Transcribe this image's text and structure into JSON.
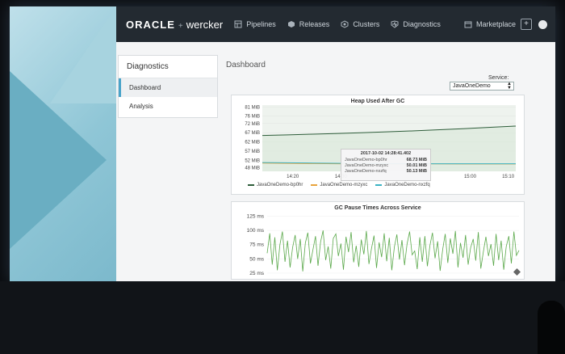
{
  "brand": {
    "oracle": "ORACLE",
    "plus": "+",
    "wercker": "wercker"
  },
  "nav": [
    {
      "label": "Pipelines",
      "icon": "pipelines-icon"
    },
    {
      "label": "Releases",
      "icon": "releases-icon"
    },
    {
      "label": "Clusters",
      "icon": "clusters-icon"
    },
    {
      "label": "Diagnostics",
      "icon": "diagnostics-icon"
    }
  ],
  "marketplace": {
    "label": "Marketplace",
    "plus": "+"
  },
  "sidebar": {
    "title": "Diagnostics",
    "items": [
      {
        "label": "Dashboard",
        "active": true
      },
      {
        "label": "Analysis",
        "active": false
      }
    ]
  },
  "main": {
    "title": "Dashboard"
  },
  "service": {
    "label": "Service:",
    "selected": "JavaOneDemo"
  },
  "colors": {
    "series1": "#2e5d3a",
    "series2": "#e8a33c",
    "series3": "#3bb3c3",
    "gcLine": "#5aa84a",
    "accent": "#49a3c9"
  },
  "heap_chart": {
    "title": "Heap Used After GC",
    "tooltip": {
      "timestamp": "2017-10-02 14:28:41.402",
      "rows": [
        {
          "name": "JavaOneDemo-bp0hr",
          "value": "68.73 MiB"
        },
        {
          "name": "JavaOneDemo-mzyxc",
          "value": "50.01 MiB"
        },
        {
          "name": "JavaOneDemo-nxzfq",
          "value": "50.13 MiB"
        }
      ]
    },
    "legend": [
      "JavaOneDemo-bp0hr",
      "JavaOneDemo-mzyxc",
      "JavaOneDemo-nxzfq"
    ]
  },
  "gc_chart": {
    "title": "GC Pause Times Across Service"
  },
  "chart_data": [
    {
      "type": "line",
      "title": "Heap Used After GC",
      "y_ticks": [
        "81 MiB",
        "76 MiB",
        "72 MiB",
        "67 MiB",
        "62 MiB",
        "57 MiB",
        "52 MiB",
        "48 MiB"
      ],
      "x_ticks": [
        "14:20",
        "14:30",
        "15:00",
        "15:10"
      ],
      "ylim": [
        46,
        82
      ],
      "series": [
        {
          "name": "JavaOneDemo-bp0hr",
          "x": [
            0,
            0.1,
            0.2,
            0.3,
            0.4,
            0.5,
            0.6,
            0.7,
            0.8,
            0.9,
            1.0
          ],
          "values": [
            65.5,
            65.8,
            66.2,
            66.6,
            67.0,
            67.5,
            68.0,
            68.6,
            69.2,
            69.9,
            70.6
          ]
        },
        {
          "name": "JavaOneDemo-mzyxc",
          "x": [
            0,
            0.2,
            0.4,
            0.6,
            0.8,
            1.0
          ],
          "values": [
            50.5,
            50.2,
            50.0,
            50.1,
            50.0,
            50.0
          ]
        },
        {
          "name": "JavaOneDemo-nxzfq",
          "x": [
            0,
            0.2,
            0.4,
            0.6,
            0.8,
            1.0
          ],
          "values": [
            50.8,
            50.5,
            50.2,
            50.1,
            50.1,
            50.1
          ]
        }
      ]
    },
    {
      "type": "line",
      "title": "GC Pause Times Across Service",
      "y_ticks": [
        "125 ms",
        "100 ms",
        "75 ms",
        "50 ms",
        "25 ms"
      ],
      "ylim": [
        15,
        130
      ],
      "series": [
        {
          "name": "",
          "values": [
            60,
            95,
            40,
            88,
            30,
            75,
            98,
            45,
            82,
            35,
            70,
            92,
            50,
            85,
            28,
            78,
            96,
            42,
            66,
            90,
            38,
            80,
            100,
            48,
            72,
            33,
            86,
            94,
            55,
            77,
            31,
            89,
            62,
            97,
            44,
            73,
            36,
            84,
            58,
            99,
            41,
            68,
            91,
            34,
            79,
            53,
            95,
            46,
            87,
            30,
            71,
            93,
            49,
            83,
            39,
            76,
            98,
            57,
            64,
            32,
            88,
            45,
            90,
            37,
            74,
            96,
            51,
            81,
            29,
            67,
            94,
            43,
            86,
            59,
            99,
            35,
            78,
            52,
            92,
            40,
            70,
            85,
            47,
            97,
            33,
            63,
            89,
            55,
            76,
            38,
            94,
            48,
            82,
            31,
            72,
            90,
            42,
            98,
            56,
            65
          ]
        }
      ]
    }
  ]
}
